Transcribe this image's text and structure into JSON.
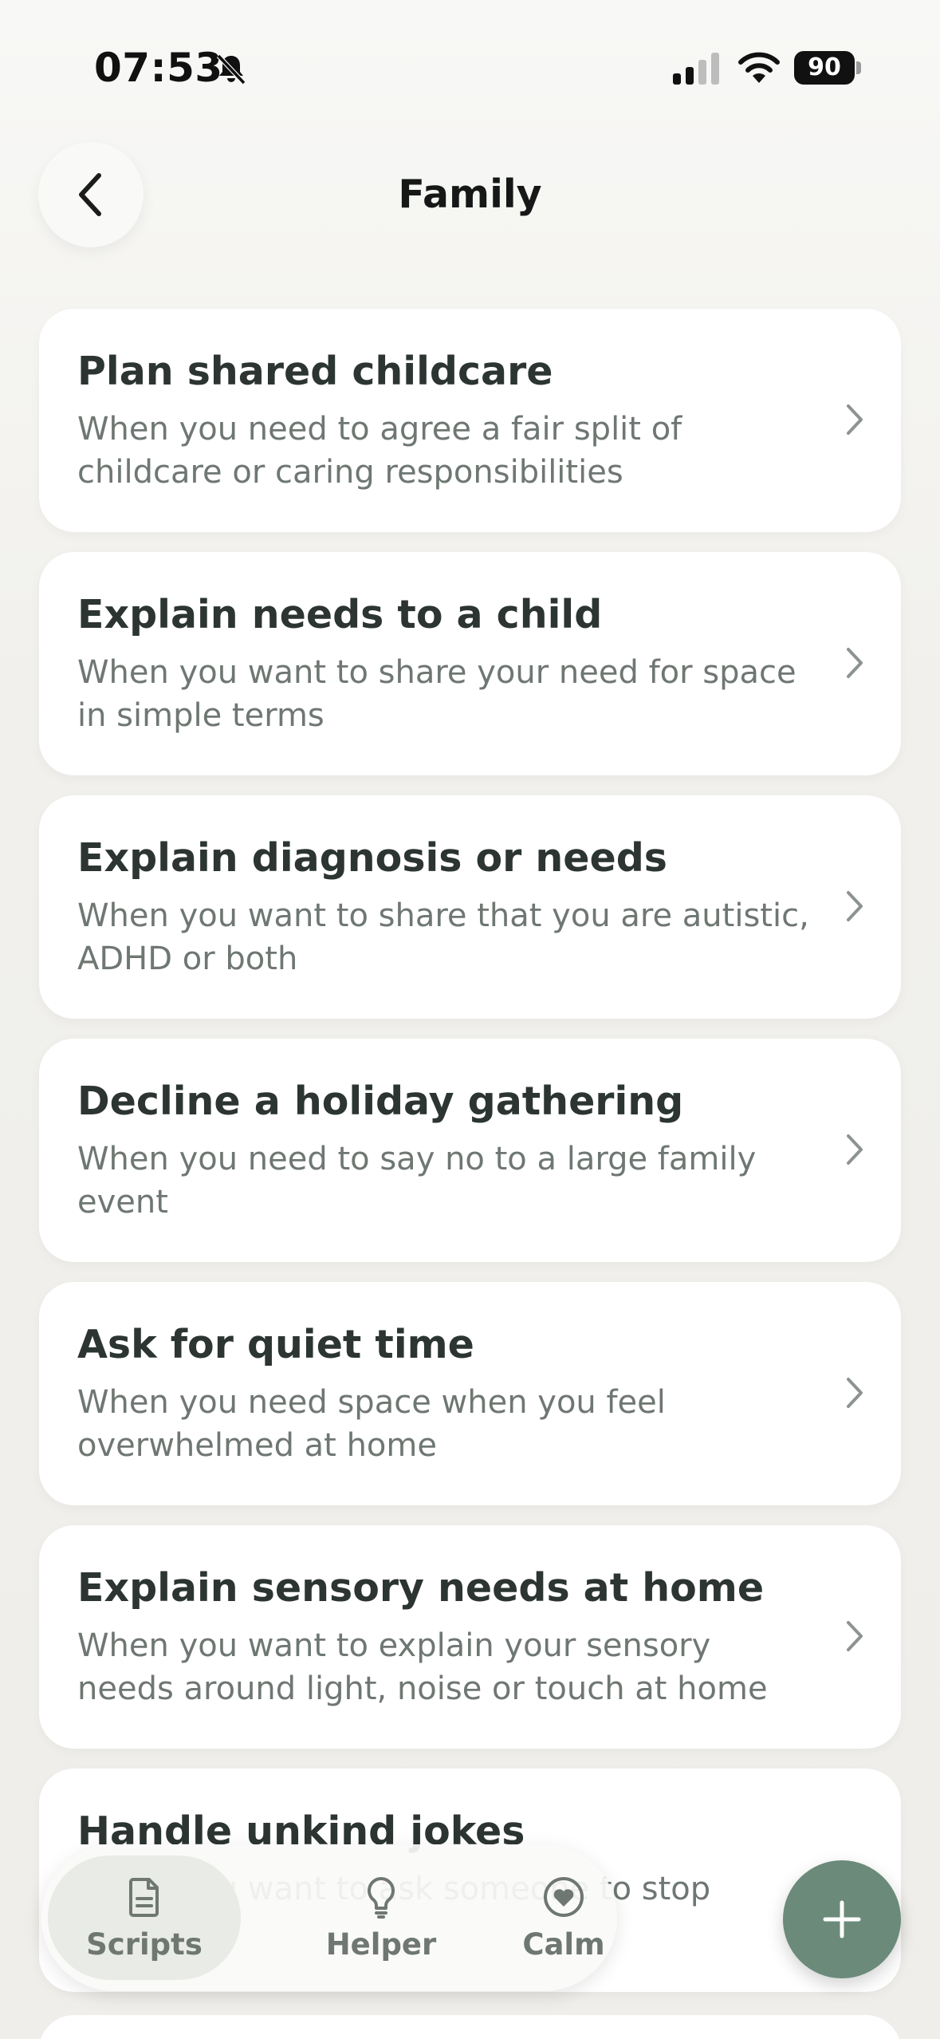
{
  "status_bar": {
    "time": "07:53",
    "battery": "90"
  },
  "header": {
    "title": "Family"
  },
  "scripts": [
    {
      "title": "Plan shared childcare",
      "description": "When you need to agree a fair split of childcare or caring responsibilities"
    },
    {
      "title": "Explain needs to a child",
      "description": "When you want to share your need for space in simple terms"
    },
    {
      "title": "Explain diagnosis or needs",
      "description": "When you want to share that you are autistic, ADHD or both"
    },
    {
      "title": "Decline a holiday gathering",
      "description": "When you need to say no to a large family event"
    },
    {
      "title": "Ask for quiet time",
      "description": "When you need space when you feel overwhelmed at home"
    },
    {
      "title": "Explain sensory needs at home",
      "description": "When you want to explain your sensory needs around light, noise or touch at home"
    },
    {
      "title": "Handle unkind jokes",
      "description": "When you want to ask someone to stop"
    }
  ],
  "bottom_nav": {
    "items": [
      {
        "label": "Scripts",
        "icon": "document-icon",
        "active": true
      },
      {
        "label": "Helper",
        "icon": "lightbulb-icon",
        "active": false
      },
      {
        "label": "Calm",
        "icon": "heart-circle-icon",
        "active": false
      }
    ]
  },
  "fab": {
    "icon": "plus-icon"
  },
  "colors": {
    "accent": "#6b8a7a",
    "card": "#ffffff",
    "background": "#f1f0ec",
    "title_text": "#2c3531",
    "secondary_text": "#6f7772"
  }
}
